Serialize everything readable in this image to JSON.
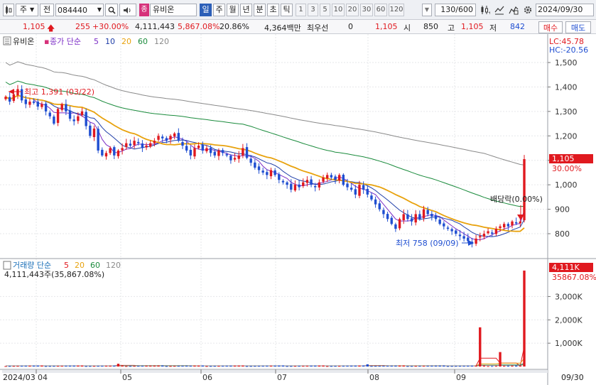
{
  "toolbar": {
    "chart_type": "주",
    "prev_label": "전",
    "code": "084440",
    "search_icon": "magnifier-icon",
    "sound_icon": "speaker-icon",
    "name_tag": "종",
    "name": "유비온",
    "periods": [
      "일",
      "주",
      "월",
      "년",
      "분",
      "초",
      "틱"
    ],
    "active_period": "일",
    "intervals": [
      "1",
      "3",
      "5",
      "10",
      "20",
      "30",
      "60",
      "120"
    ],
    "count": "130/600",
    "date": "2024/09/30"
  },
  "infobar": {
    "price": "1,105",
    "change": "255",
    "change_pct": "+30.00%",
    "volume": "4,111,443",
    "volume_pct": "5,867.08%",
    "turnover": "20.86%",
    "amount": "4,364백만",
    "pref_label": "최우선",
    "pref_value": "0",
    "ask": "1,105",
    "open_label": "시",
    "open": "850",
    "high_label": "고",
    "high": "1,105",
    "low_label": "저",
    "low": "842",
    "buy_button": "매수",
    "sell_button": "매도"
  },
  "price_panel": {
    "legend_name": "유비온",
    "legend_label": "종가 단순",
    "ma_periods": [
      "5",
      "10",
      "20",
      "60",
      "120"
    ],
    "ma_colors": [
      "#7c2ec6",
      "#1f3ea8",
      "#e8a20d",
      "#1a8b3c",
      "#8a8a8a"
    ],
    "lc": "LC:45.78",
    "hc": "HC:-20.56",
    "current_price": "1,105",
    "current_pct": "30.00%",
    "high_note": "최고 1,391 (03/22)",
    "low_note": "최저 758 (09/09)",
    "dividend_note": "배당락(0.00%)"
  },
  "volume_panel": {
    "legend_label": "거래량 단순",
    "ma_periods": [
      "5",
      "20",
      "60",
      "120"
    ],
    "ma_colors": [
      "#e0191f",
      "#e8a20d",
      "#1a8b3c",
      "#8a8a8a"
    ],
    "info": "4,111,443주(35,867.08%)",
    "current_volume": "4,111K",
    "current_pct": "35867.08%"
  },
  "x_axis": {
    "start_label": "2024/03",
    "end_label": "09/30",
    "month_labels": [
      "04",
      "05",
      "06",
      "07",
      "08",
      "09"
    ]
  },
  "chart_data": [
    {
      "type": "candlestick",
      "name": "유비온",
      "x_range": [
        "2024-03-15",
        "2024-09-30"
      ],
      "y_axis_ticks": [
        800,
        900,
        1000,
        1100,
        1200,
        1300,
        1400,
        1500
      ],
      "ylim": [
        745,
        1560
      ],
      "close": [
        1360,
        1340,
        1370,
        1391,
        1345,
        1330,
        1340,
        1335,
        1320,
        1330,
        1300,
        1280,
        1250,
        1310,
        1330,
        1300,
        1270,
        1260,
        1280,
        1300,
        1240,
        1200,
        1230,
        1140,
        1120,
        1130,
        1150,
        1120,
        1140,
        1150,
        1170,
        1160,
        1180,
        1170,
        1150,
        1160,
        1170,
        1180,
        1200,
        1190,
        1180,
        1200,
        1210,
        1180,
        1160,
        1140,
        1120,
        1150,
        1160,
        1140,
        1150,
        1130,
        1120,
        1140,
        1130,
        1120,
        1100,
        1110,
        1120,
        1150,
        1110,
        1090,
        1070,
        1060,
        1050,
        1040,
        1060,
        1040,
        1020,
        1010,
        1000,
        980,
        1000,
        990,
        1010,
        1020,
        1000,
        990,
        1010,
        1030,
        1040,
        1030,
        1020,
        1040,
        1000,
        990,
        980,
        960,
        1000,
        980,
        960,
        940,
        920,
        900,
        880,
        860,
        840,
        820,
        860,
        880,
        860,
        850,
        880,
        860,
        900,
        880,
        870,
        860,
        840,
        830,
        820,
        810,
        800,
        790,
        780,
        770,
        758,
        780,
        790,
        800,
        810,
        800,
        820,
        830,
        840,
        830,
        850,
        842,
        850,
        1105
      ],
      "ma_periods": [
        5,
        10,
        20,
        60,
        120
      ]
    },
    {
      "type": "bar",
      "name": "거래량",
      "y_axis_ticks": [
        "1,000K",
        "2,000K",
        "3,000K"
      ],
      "ylim": [
        0,
        4200000
      ],
      "spikes": [
        {
          "index": 28,
          "value": 120000
        },
        {
          "index": 90,
          "value": 95000
        },
        {
          "index": 118,
          "value": 1680000
        },
        {
          "index": 123,
          "value": 620000
        },
        {
          "index": 129,
          "value": 4111443
        }
      ],
      "base_value": 30000
    }
  ]
}
